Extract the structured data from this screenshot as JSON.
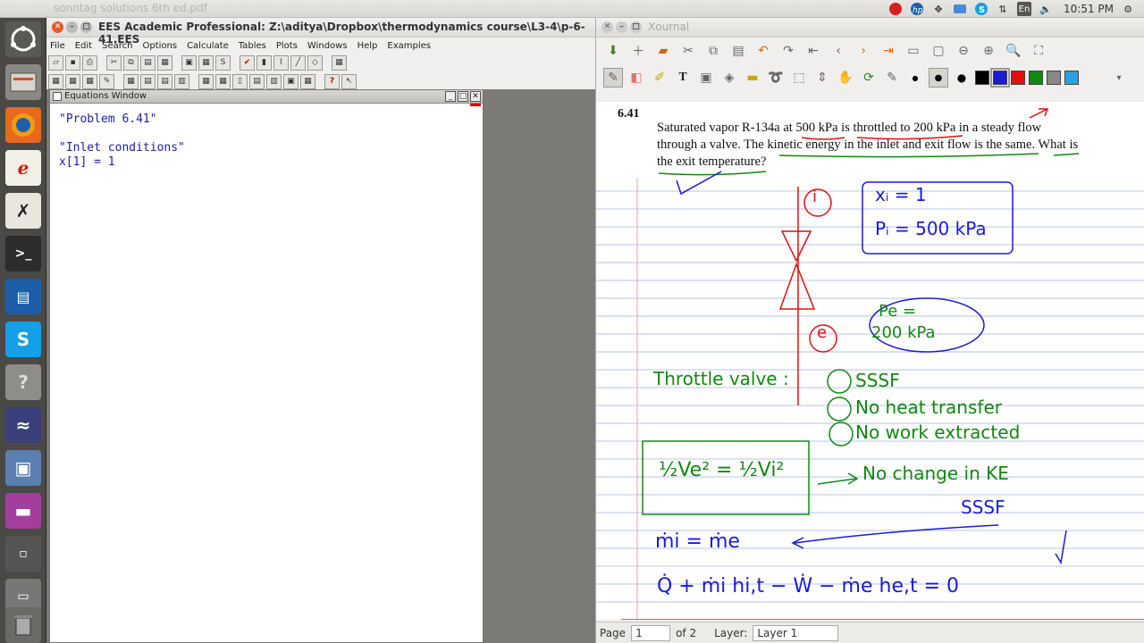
{
  "top_panel": {
    "background_title": "sonntag solutions 6th ed.pdf",
    "lang": "En",
    "clock": "10:51 PM"
  },
  "ees": {
    "title": "EES Academic Professional:  Z:\\aditya\\Dropbox\\thermodynamics course\\L3-4\\p-6-41.EES",
    "menu": [
      "File",
      "Edit",
      "Search",
      "Options",
      "Calculate",
      "Tables",
      "Plots",
      "Windows",
      "Help",
      "Examples"
    ],
    "equations_window": {
      "title": "Equations Window",
      "lines": [
        "\"Problem 6.41\"",
        "",
        "\"Inlet conditions\"",
        "x[1] = 1"
      ]
    }
  },
  "xournal": {
    "title": "Xournal",
    "colors": [
      "#000000",
      "#1a1ad8",
      "#e01010",
      "#118811",
      "#888888",
      "#29a3e0"
    ],
    "problem_number": "6.41",
    "problem_lines": [
      "Saturated vapor R-134a at 500 kPa is throttled to 200 kPa in a steady flow",
      "through a valve. The kinetic energy in the inlet and exit flow is the same. What is",
      "the exit temperature?"
    ],
    "handwriting": {
      "inlet_label": "i",
      "exit_label": "e",
      "inlet_box_1": "xᵢ = 1",
      "inlet_box_2": "Pᵢ = 500 kPa",
      "exit_1": "Pe =",
      "exit_2": "200 kPa",
      "throttle": "Throttle valve :",
      "point_a": "SSSF",
      "point_b": "No heat transfer",
      "point_c": "No work extracted",
      "ke_eq": "½Ve² = ½Vi²",
      "ke_note": "No change in KE",
      "sssf": "SSSF",
      "mass_eq": "ṁi = ṁe",
      "energy_eq": "Q̇ + ṁi hi,t − Ẇ − ṁe he,t = 0"
    },
    "status": {
      "page_label": "Page",
      "page_value": "1",
      "of_pages": "of 2",
      "layer_label": "Layer:",
      "layer_value": "Layer 1"
    }
  }
}
